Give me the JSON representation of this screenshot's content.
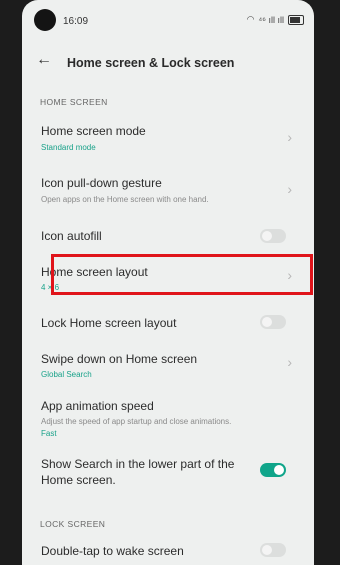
{
  "status": {
    "time": "16:09",
    "signal": "⁴⁶ ıll ıll"
  },
  "header": {
    "back_icon": "back-arrow-icon",
    "title": "Home screen & Lock screen"
  },
  "sections": {
    "home": "HOME SCREEN",
    "lock": "LOCK SCREEN"
  },
  "items": [
    {
      "label": "Home screen mode",
      "sub": "Standard mode",
      "control": "chevron"
    },
    {
      "label": "Icon pull-down gesture",
      "sub": "Open apps on the Home screen with one hand.",
      "control": "chevron"
    },
    {
      "label": "Icon autofill",
      "sub": "",
      "control": "toggle",
      "on": false
    },
    {
      "label": "Home screen layout",
      "sub": "4 × 6",
      "control": "chevron"
    },
    {
      "label": "Lock Home screen layout",
      "sub": "",
      "control": "toggle",
      "on": false
    },
    {
      "label": "Swipe down on Home screen",
      "sub": "Global Search",
      "control": "chevron"
    },
    {
      "label": "App animation speed",
      "sub": "Adjust the speed of app startup and close animations.",
      "sub2": "Fast",
      "control": "none"
    },
    {
      "label": "Show Search in the lower part of the",
      "label2": "Home screen.",
      "control": "toggle",
      "on": true
    },
    {
      "label": "Double-tap to wake screen",
      "sub": "",
      "control": "toggle",
      "on": false
    }
  ],
  "colors": {
    "accent": "#10a58a",
    "highlight": "#e0141b",
    "background": "#eef0ef"
  }
}
